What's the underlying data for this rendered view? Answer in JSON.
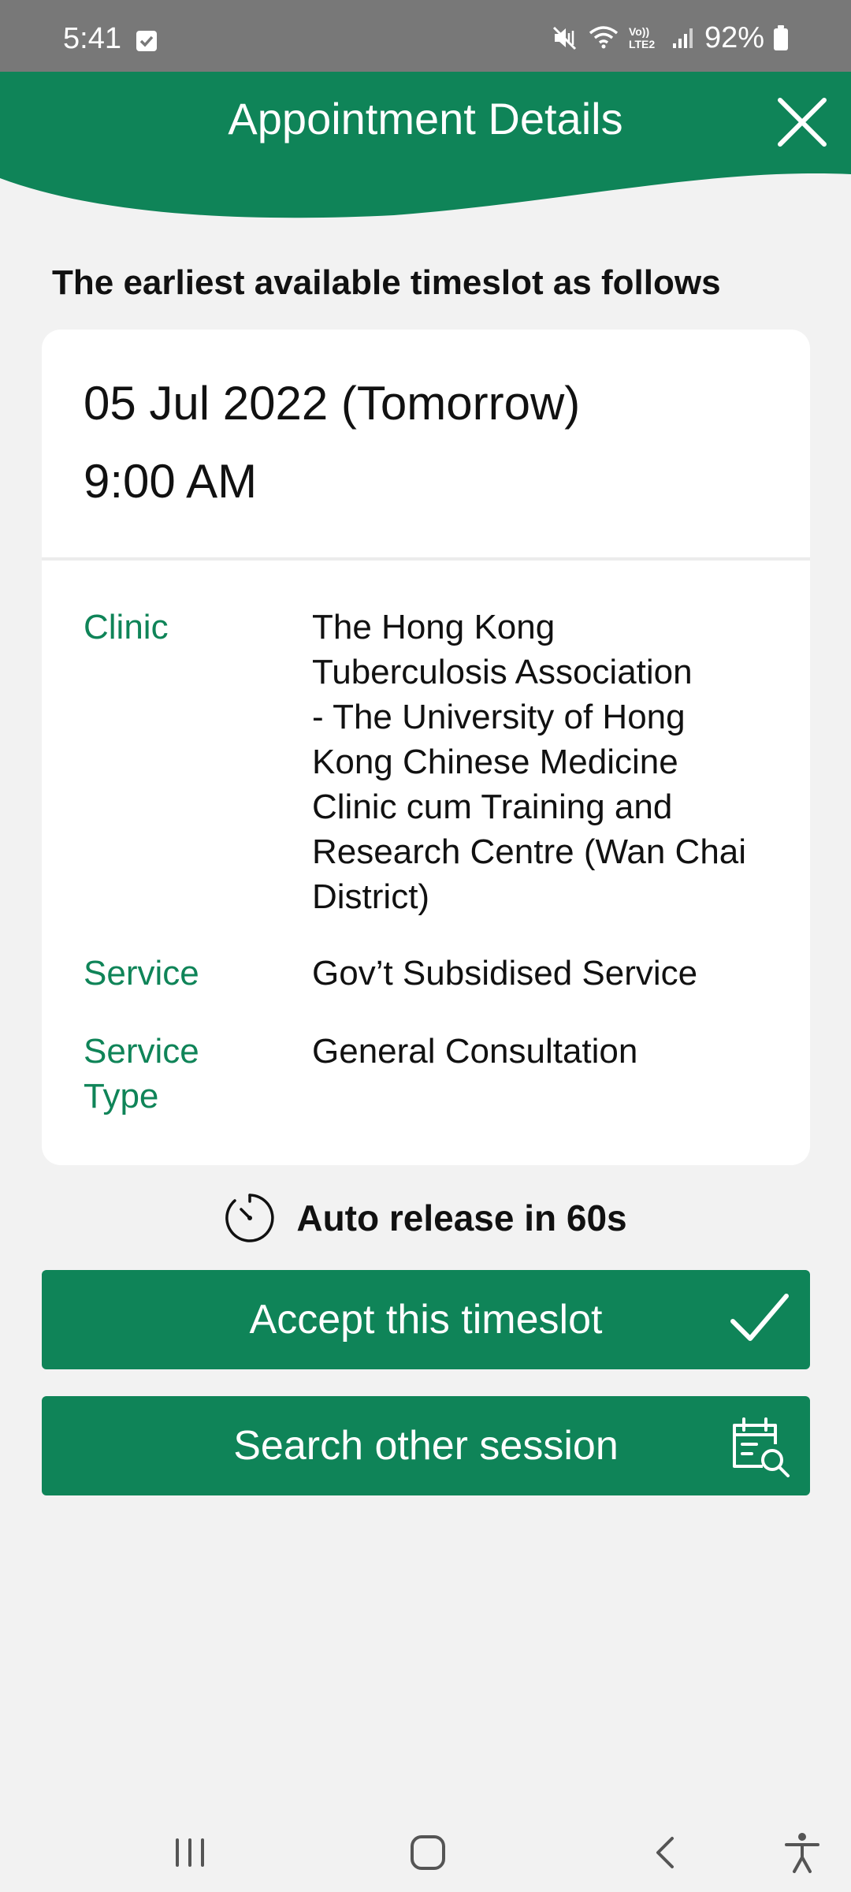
{
  "status_bar": {
    "time": "5:41",
    "battery": "92%",
    "icons": [
      "checkbox-notification-icon",
      "mute-vibrate-icon",
      "wifi-icon",
      "volte-icon",
      "signal-icon",
      "battery-icon"
    ],
    "volte_label": "Vo)) LTE2"
  },
  "header": {
    "title": "Appointment Details",
    "close_icon": "close-icon",
    "brand_color": "#0f8458"
  },
  "subtitle": "The earliest available timeslot as follows",
  "appointment": {
    "date": "05 Jul 2022 (Tomorrow)",
    "time": "9:00 AM",
    "details": [
      {
        "label": "Clinic",
        "value_lines": [
          "The Hong Kong",
          "Tuberculosis Association",
          "- The University of Hong",
          "Kong Chinese Medicine",
          "Clinic cum Training and",
          "Research Centre (Wan Chai",
          "District)"
        ]
      },
      {
        "label": "Service",
        "value_lines": [
          "Gov’t Subsidised Service"
        ]
      },
      {
        "label_lines": [
          "Service",
          "Type"
        ],
        "value_lines": [
          "General Consultation"
        ]
      }
    ]
  },
  "auto_release": {
    "text": "Auto release in 60s",
    "icon": "timer-icon"
  },
  "buttons": {
    "accept": {
      "label": "Accept this timeslot",
      "icon": "checkmark-icon"
    },
    "search": {
      "label": "Search other session",
      "icon": "calendar-search-icon"
    }
  },
  "nav_bar": {
    "items": [
      "recent-apps-icon",
      "home-icon",
      "back-icon",
      "accessibility-icon"
    ]
  }
}
